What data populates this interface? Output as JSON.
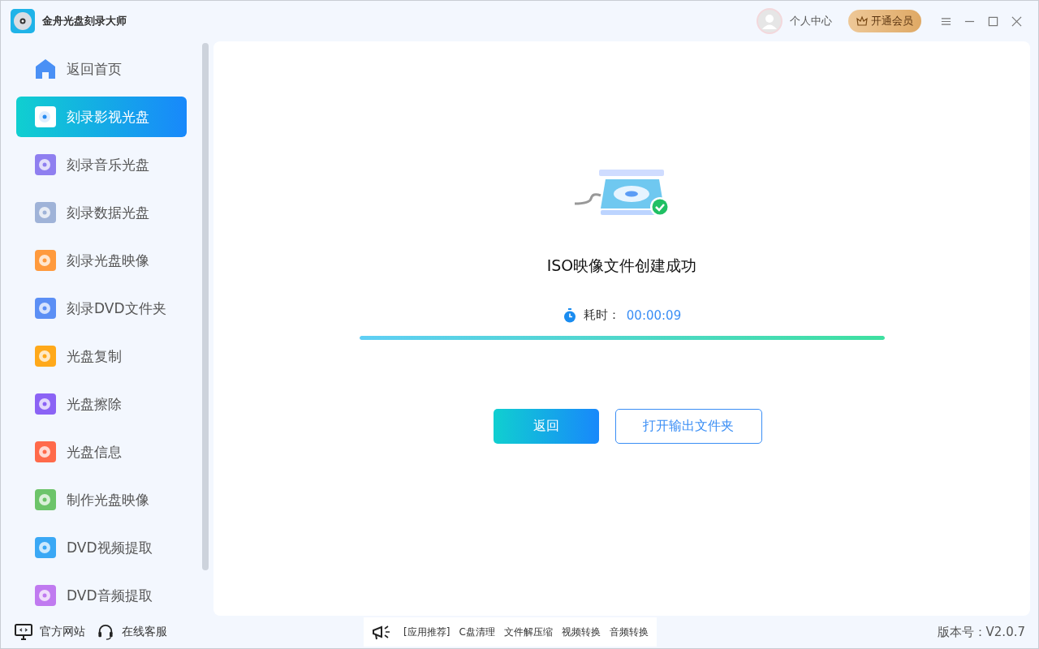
{
  "app": {
    "title": "金舟光盘刻录大师"
  },
  "header": {
    "user_label": "个人中心",
    "vip_button": "开通会员"
  },
  "sidebar": {
    "items": [
      {
        "label": "返回首页",
        "kind": "home",
        "selected": false,
        "color": "#4a90f5"
      },
      {
        "label": "刻录影视光盘",
        "kind": "tile",
        "selected": true,
        "color": "#ffffff"
      },
      {
        "label": "刻录音乐光盘",
        "kind": "tile",
        "selected": false,
        "color": "#8f7ff0"
      },
      {
        "label": "刻录数据光盘",
        "kind": "tile",
        "selected": false,
        "color": "#9fb3d8"
      },
      {
        "label": "刻录光盘映像",
        "kind": "tile",
        "selected": false,
        "color": "#ff9a3d"
      },
      {
        "label": "刻录DVD文件夹",
        "kind": "tile",
        "selected": false,
        "color": "#5b8ff5"
      },
      {
        "label": "光盘复制",
        "kind": "tile",
        "selected": false,
        "color": "#ffa91a"
      },
      {
        "label": "光盘擦除",
        "kind": "tile",
        "selected": false,
        "color": "#8b63f5"
      },
      {
        "label": "光盘信息",
        "kind": "tile",
        "selected": false,
        "color": "#ff6a4a"
      },
      {
        "label": "制作光盘映像",
        "kind": "tile",
        "selected": false,
        "color": "#6cc46a"
      },
      {
        "label": "DVD视频提取",
        "kind": "tile",
        "selected": false,
        "color": "#3aa8f5"
      },
      {
        "label": "DVD音频提取",
        "kind": "tile",
        "selected": false,
        "color": "#c07af0"
      }
    ],
    "footer_links": [
      "官方网站",
      "在线客服"
    ]
  },
  "result": {
    "message": "ISO映像文件创建成功",
    "elapsed_label": "耗时：",
    "elapsed_value": "00:00:09",
    "level": 1.0,
    "buttons": [
      "返回",
      "打开输出文件夹"
    ]
  },
  "status_bar": {
    "promo_label": "[应用推荐]",
    "promo_links": [
      "C盘清理",
      "文件解压缩",
      "视频转换",
      "音频转换"
    ],
    "version": "版本号：V2.0.7"
  }
}
